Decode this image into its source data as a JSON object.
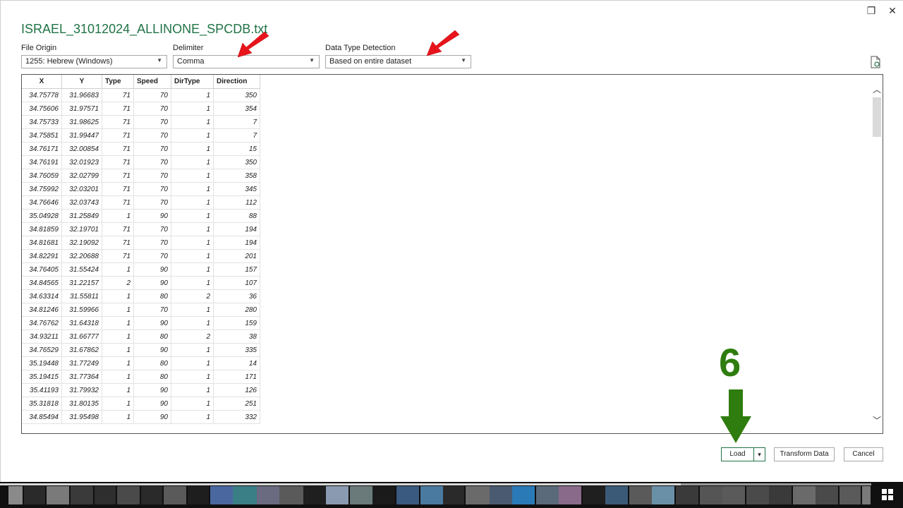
{
  "window": {
    "title": "ISRAEL_31012024_ALLINONE_SPCDB.txt",
    "restore_icon": "❐",
    "close_icon": "✕"
  },
  "controls": {
    "file_origin": {
      "label": "File Origin",
      "value": "1255: Hebrew (Windows)"
    },
    "delimiter": {
      "label": "Delimiter",
      "value": "Comma"
    },
    "data_type_detection": {
      "label": "Data Type Detection",
      "value": "Based on entire dataset"
    }
  },
  "table": {
    "columns": [
      "X",
      "Y",
      "Type",
      "Speed",
      "DirType",
      "Direction"
    ],
    "rows": [
      [
        "34.75778",
        "31.96683",
        "71",
        "70",
        "1",
        "350"
      ],
      [
        "34.75606",
        "31.97571",
        "71",
        "70",
        "1",
        "354"
      ],
      [
        "34.75733",
        "31.98625",
        "71",
        "70",
        "1",
        "7"
      ],
      [
        "34.75851",
        "31.99447",
        "71",
        "70",
        "1",
        "7"
      ],
      [
        "34.76171",
        "32.00854",
        "71",
        "70",
        "1",
        "15"
      ],
      [
        "34.76191",
        "32.01923",
        "71",
        "70",
        "1",
        "350"
      ],
      [
        "34.76059",
        "32.02799",
        "71",
        "70",
        "1",
        "358"
      ],
      [
        "34.75992",
        "32.03201",
        "71",
        "70",
        "1",
        "345"
      ],
      [
        "34.76646",
        "32.03743",
        "71",
        "70",
        "1",
        "112"
      ],
      [
        "35.04928",
        "31.25849",
        "1",
        "90",
        "1",
        "88"
      ],
      [
        "34.81859",
        "32.19701",
        "71",
        "70",
        "1",
        "194"
      ],
      [
        "34.81681",
        "32.19092",
        "71",
        "70",
        "1",
        "194"
      ],
      [
        "34.82291",
        "32.20688",
        "71",
        "70",
        "1",
        "201"
      ],
      [
        "34.76405",
        "31.55424",
        "1",
        "90",
        "1",
        "157"
      ],
      [
        "34.84565",
        "31.22157",
        "2",
        "90",
        "1",
        "107"
      ],
      [
        "34.63314",
        "31.55811",
        "1",
        "80",
        "2",
        "36"
      ],
      [
        "34.81246",
        "31.59966",
        "1",
        "70",
        "1",
        "280"
      ],
      [
        "34.76762",
        "31.64318",
        "1",
        "90",
        "1",
        "159"
      ],
      [
        "34.93211",
        "31.66777",
        "1",
        "80",
        "2",
        "38"
      ],
      [
        "34.76529",
        "31.67862",
        "1",
        "90",
        "1",
        "335"
      ],
      [
        "35.19448",
        "31.77249",
        "1",
        "80",
        "1",
        "14"
      ],
      [
        "35.19415",
        "31.77364",
        "1",
        "80",
        "1",
        "171"
      ],
      [
        "35.41193",
        "31.79932",
        "1",
        "90",
        "1",
        "126"
      ],
      [
        "35.31818",
        "31.80135",
        "1",
        "90",
        "1",
        "251"
      ],
      [
        "34.85494",
        "31.95498",
        "1",
        "90",
        "1",
        "332"
      ]
    ]
  },
  "annotation": {
    "step_number": "6",
    "arrow_color": "#2e7d0e",
    "pointer_color": "#e8141c"
  },
  "buttons": {
    "load": "Load",
    "load_dropdown_icon": "▾",
    "transform": "Transform Data",
    "cancel": "Cancel"
  },
  "colors": {
    "accent": "#217346"
  }
}
